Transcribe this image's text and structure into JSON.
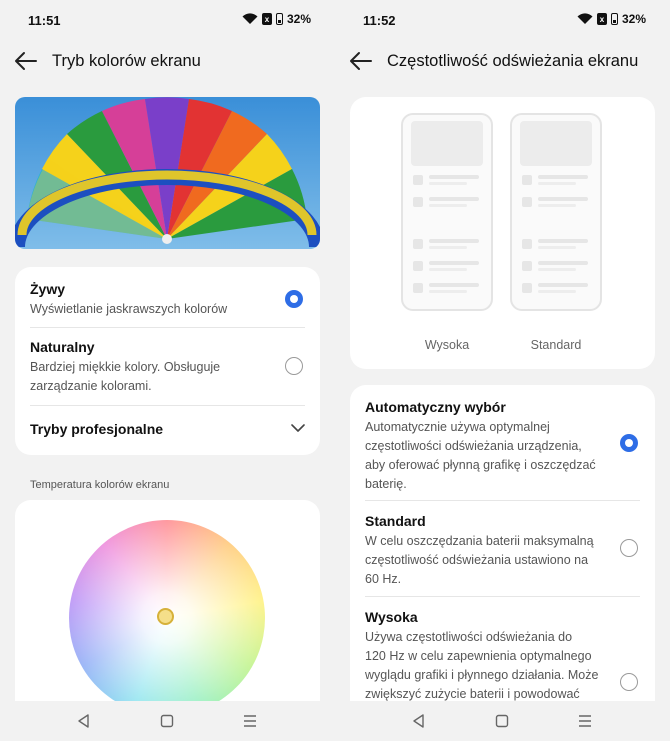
{
  "left": {
    "status": {
      "time": "11:51",
      "battery": "32%",
      "sim": "x"
    },
    "title": "Tryb kolorów ekranu",
    "options": [
      {
        "title": "Żywy",
        "desc": "Wyświetlanie jaskrawszych kolorów",
        "selected": true
      },
      {
        "title": "Naturalny",
        "desc_lines": [
          "Bardziej miękkie kolory. Obsługuje",
          "zarządzanie kolorami."
        ],
        "selected": false
      }
    ],
    "pro_modes": "Tryby profesjonalne",
    "temperature_label": "Temperatura kolorów ekranu"
  },
  "right": {
    "status": {
      "time": "11:52",
      "battery": "32%",
      "sim": "x"
    },
    "title": "Częstotliwość odświeżania ekranu",
    "preview_labels": [
      "Wysoka",
      "Standard"
    ],
    "options": [
      {
        "title": "Automatyczny wybór",
        "desc_lines": [
          "Automatycznie używa optymalnej",
          "częstotliwości odświeżania urządzenia,",
          "aby oferować płynną grafikę i oszczędzać",
          "baterię."
        ],
        "selected": true
      },
      {
        "title": "Standard",
        "desc_lines": [
          "W celu oszczędzania baterii maksymalną",
          "częstotliwość odświeżania ustawiono na",
          "60 Hz."
        ],
        "selected": false
      },
      {
        "title": "Wysoka",
        "desc_lines": [
          "Używa częstotliwości odświeżania do",
          "120 Hz w celu zapewnienia optymalnego",
          "wyglądu grafiki i płynnego działania. Może",
          "zwiększyć zużycie baterii i powodować"
        ],
        "selected": false
      }
    ]
  },
  "colors": {
    "accent": "#2e6de6",
    "background": "#f2f2f2",
    "card": "#ffffff"
  }
}
